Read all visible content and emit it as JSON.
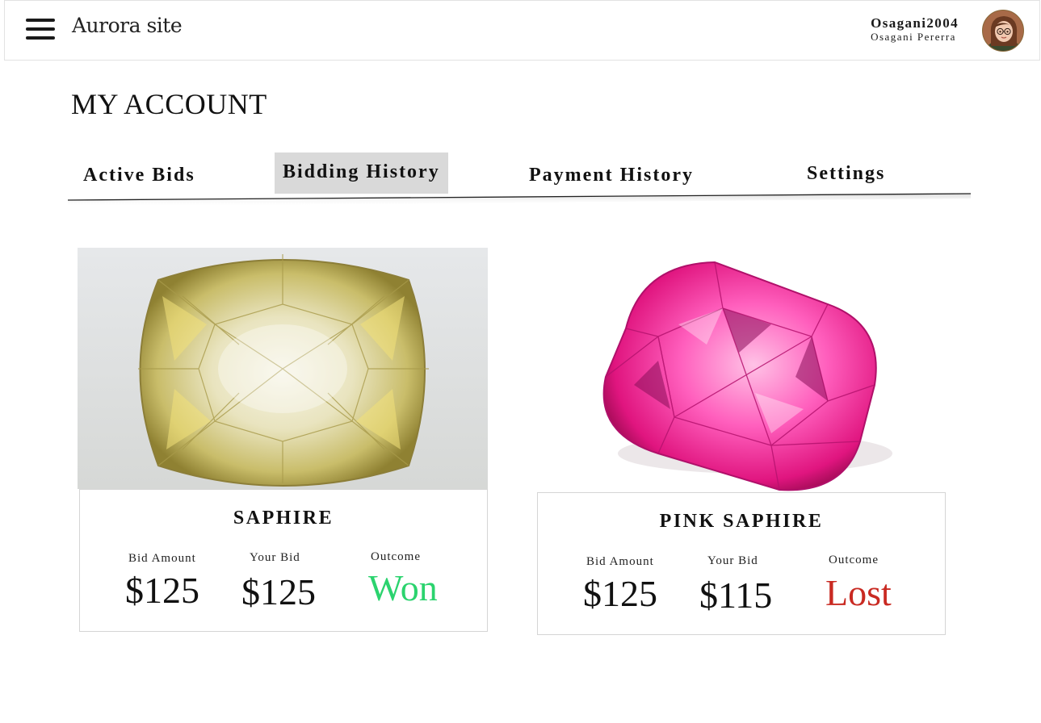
{
  "header": {
    "site_title": "Aurora site",
    "menu_icon": "hamburger-menu-icon",
    "username": "Osagani2004",
    "full_name": "Osagani Pererra"
  },
  "page": {
    "title": "MY ACCOUNT"
  },
  "tabs": [
    {
      "label": "Active Bids",
      "active": false
    },
    {
      "label": "Bidding History",
      "active": true
    },
    {
      "label": "Payment History",
      "active": false
    },
    {
      "label": "Settings",
      "active": false
    }
  ],
  "colors": {
    "won": "#2bd36e",
    "lost": "#c92a22",
    "active_tab_bg": "#d9d9d9"
  },
  "cards": [
    {
      "name": "SAPHIRE",
      "bid_amount_label": "Bid Amount",
      "bid_amount": "$125",
      "your_bid_label": "Your Bid",
      "your_bid": "$125",
      "outcome_label": "Outcome",
      "outcome": "Won"
    },
    {
      "name": "PINK SAPHIRE",
      "bid_amount_label": "Bid Amount",
      "bid_amount": "$125",
      "your_bid_label": "Your Bid",
      "your_bid": "$115",
      "outcome_label": "Outcome",
      "outcome": "Lost"
    }
  ]
}
